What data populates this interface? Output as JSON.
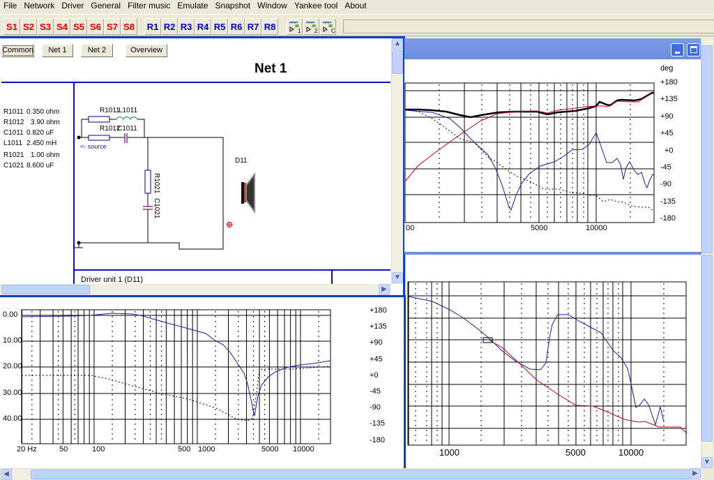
{
  "menu": [
    "File",
    "Network",
    "Driver",
    "General",
    "Filter music",
    "Emulate",
    "Snapshot",
    "Window",
    "Yankee tool",
    "About"
  ],
  "toolbar": {
    "s_buttons": [
      "S1",
      "S2",
      "S3",
      "S4",
      "S5",
      "S6",
      "S7",
      "S8"
    ],
    "r_buttons": [
      "R1",
      "R2",
      "R3",
      "R4",
      "R5",
      "R6",
      "R7",
      "R8"
    ],
    "tool_icons": [
      "filter-1-icon",
      "filter-2-icon",
      "filter-c-icon"
    ],
    "colors": {
      "s": "#e00000",
      "r": "#0000c0"
    }
  },
  "net_window": {
    "tabs": [
      "Common",
      "Net 1",
      "Net 2",
      "Overview"
    ],
    "title": "Net 1",
    "components": [
      {
        "name": "R1011",
        "value": "0.350 ohm"
      },
      {
        "name": "R1012",
        "value": "3.90 ohm"
      },
      {
        "name": "C1011",
        "value": "0.820 uF"
      },
      {
        "name": "L1011",
        "value": "2.450 mH"
      },
      {
        "name": "R1021",
        "value": "1.00 ohm"
      },
      {
        "name": "C1021",
        "value": "8.600 uF"
      }
    ],
    "schematic": {
      "r1011": "R1011",
      "l1011": "L1011",
      "r1012": "R1012",
      "c1011": "C1011",
      "r1021": "R1021",
      "c1021": "C1021",
      "driver": "D11",
      "source": "<- source"
    },
    "driver_panel": "Driver unit 1 (D11)"
  },
  "response_chart": {
    "y_left": [
      "0.00",
      "10.00",
      "20.00",
      "30.00",
      "40.00"
    ],
    "y_right": [
      "+180",
      "+135",
      "+90",
      "+45",
      "+0",
      "-45",
      "-90",
      "-135",
      "-180"
    ],
    "x": [
      "20 Hz",
      "50",
      "100",
      "500",
      "1000",
      "5000",
      "10000"
    ]
  },
  "phase_chart": {
    "unit": "deg",
    "y_right": [
      "+180",
      "+135",
      "+90",
      "+45",
      "+0",
      "-45",
      "-90",
      "-135",
      "-180"
    ],
    "x": [
      "00",
      "5000",
      "10000"
    ]
  },
  "impedance_chart": {
    "x": [
      "1000",
      "5000",
      "10000"
    ]
  }
}
